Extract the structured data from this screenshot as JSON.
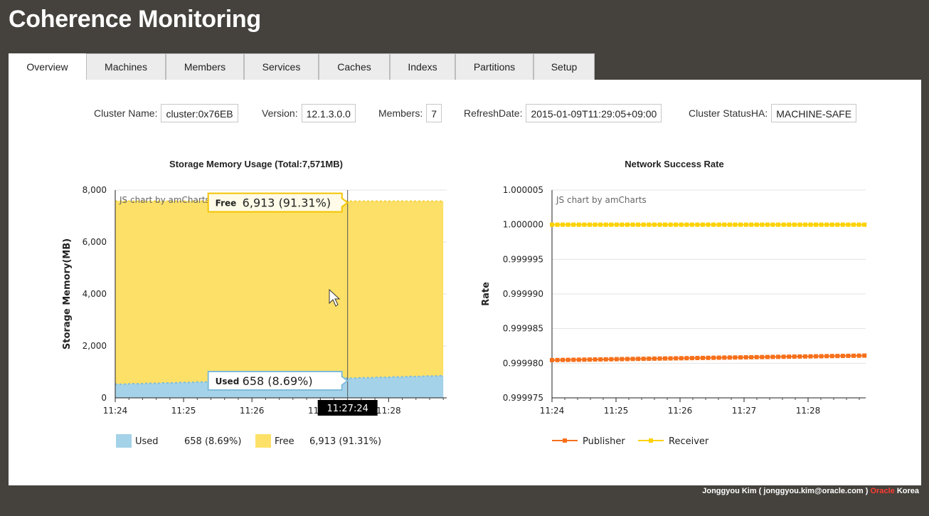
{
  "app": {
    "title": "Coherence Monitoring"
  },
  "colors": {
    "background": "#45423d",
    "used_fill": "#a4d2e8",
    "free_fill": "#fde068",
    "publisher": "#f6701b",
    "receiver": "#fcd202",
    "brand_red": "#ff3b30"
  },
  "tabs": [
    {
      "label": "Overview",
      "active": true
    },
    {
      "label": "Machines",
      "active": false
    },
    {
      "label": "Members",
      "active": false
    },
    {
      "label": "Services",
      "active": false
    },
    {
      "label": "Caches",
      "active": false
    },
    {
      "label": "Indexs",
      "active": false
    },
    {
      "label": "Partitions",
      "active": false
    },
    {
      "label": "Setup",
      "active": false
    }
  ],
  "cluster_info": {
    "cluster_name": {
      "label": "Cluster Name:",
      "value": "cluster:0x76EB"
    },
    "version": {
      "label": "Version:",
      "value": "12.1.3.0.0"
    },
    "members": {
      "label": "Members:",
      "value": "7"
    },
    "refresh_date": {
      "label": "RefreshDate:",
      "value": "2015-01-09T11:29:05+09:00"
    },
    "status_ha": {
      "label": "Cluster StatusHA:",
      "value": "MACHINE-SAFE"
    }
  },
  "chart_data": [
    {
      "type": "area",
      "title": "Storage Memory Usage (Total:7,571MB)",
      "ylabel": "Storage Memory(MB)",
      "xlabel": "",
      "credit": "JS chart by amCharts",
      "stacked": true,
      "xlim_minutes": [
        0,
        4.85
      ],
      "x_ticks": [
        "11:24",
        "11:25",
        "11:26",
        "11:27",
        "11:28"
      ],
      "y_ticks": [
        "0",
        "2,000",
        "4,000",
        "6,000",
        "8,000"
      ],
      "ylim": [
        0,
        8000
      ],
      "total": 7571,
      "series": [
        {
          "name": "Used",
          "start": 520,
          "end": 850,
          "hover_value": 658,
          "hover_pct": "8.69%",
          "legend_value": "658 (8.69%)"
        },
        {
          "name": "Free",
          "hover_value": 6913,
          "hover_pct": "91.31%",
          "legend_value": "6,913 (91.31%)"
        }
      ],
      "cursor": {
        "time": "11:27:24",
        "minute_offset": 3.4,
        "used_label": "658 (8.69%)",
        "free_label": "6,913 (91.31%)"
      },
      "legend_position": "bottom"
    },
    {
      "type": "line",
      "title": "Network Success Rate",
      "ylabel": "Rate",
      "xlabel": "",
      "credit": "JS chart by amCharts",
      "xlim_minutes": [
        0,
        4.9
      ],
      "x_ticks": [
        "11:24",
        "11:25",
        "11:26",
        "11:27",
        "11:28"
      ],
      "y_ticks": [
        "0.999975",
        "0.999980",
        "0.999985",
        "0.999990",
        "0.999995",
        "1.000000",
        "1.000005"
      ],
      "ylim": [
        0.999975,
        1.000005
      ],
      "series": [
        {
          "name": "Publisher",
          "start": 0.99998045,
          "end": 0.9999811
        },
        {
          "name": "Receiver",
          "start": 1.0,
          "end": 1.0
        }
      ],
      "legend_position": "bottom"
    }
  ],
  "footer": {
    "author": "Jonggyou Kim ( jonggyou.kim@oracle.com )",
    "brand": "Oracle",
    "suffix": "Korea"
  }
}
